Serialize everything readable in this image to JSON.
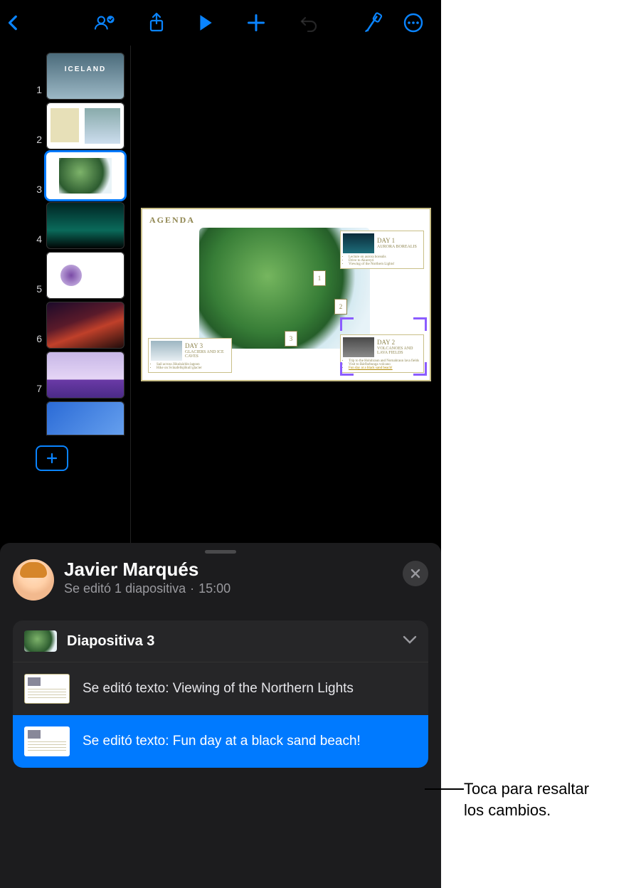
{
  "toolbar": {
    "icons": [
      "back",
      "collaborate",
      "share",
      "play",
      "add",
      "undo",
      "format",
      "more"
    ]
  },
  "thumbnails": {
    "selected_index": 3,
    "items": [
      {
        "num": "1"
      },
      {
        "num": "2"
      },
      {
        "num": "3"
      },
      {
        "num": "4"
      },
      {
        "num": "5"
      },
      {
        "num": "6"
      },
      {
        "num": "7"
      }
    ]
  },
  "slide": {
    "title": "AGENDA",
    "map_markers": [
      "1",
      "2",
      "3"
    ],
    "day1": {
      "label": "DAY 1",
      "subtitle": "AURORA BOREALIS",
      "bullets": [
        "Lecture on aurora borealis",
        "Drive to Akureyri",
        "Viewing of the Northern Lights!"
      ]
    },
    "day2": {
      "label": "DAY 2",
      "subtitle": "VOLCANOES AND LAVA FIELDS",
      "bullets": [
        "Trip to the Holuhraun and Nornahraun lava fields",
        "Visit to Bárðarbunga volcano",
        "Fun day at a black sand beach!"
      ]
    },
    "day3": {
      "label": "DAY 3",
      "subtitle": "GLACIERS AND ICE CAVES",
      "bullets": [
        "Sail across Jökulsárlón lagoon",
        "Hike on Svínafellsjökull glacier"
      ]
    }
  },
  "activity": {
    "author": "Javier Marqués",
    "summary": "Se editó 1 diapositiva",
    "time": "15:00",
    "slide_label": "Diapositiva 3",
    "edits": [
      {
        "text": "Se editó texto: Viewing of the Northern Lights",
        "selected": false
      },
      {
        "text": "Se editó texto: Fun day at a black sand beach!",
        "selected": true
      }
    ]
  },
  "callout": {
    "line1": "Toca para resaltar",
    "line2": "los cambios."
  }
}
